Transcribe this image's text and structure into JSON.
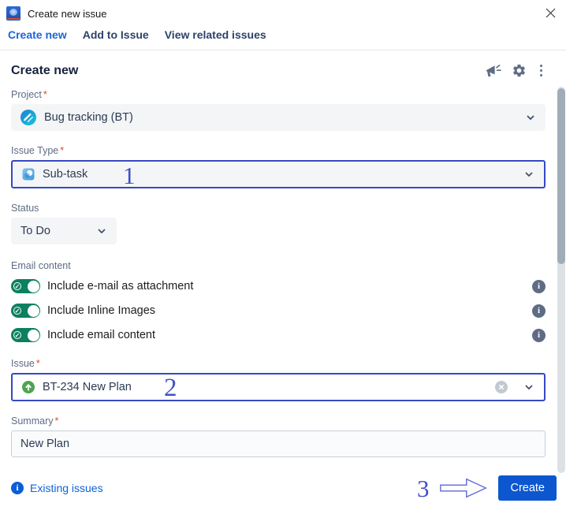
{
  "window": {
    "title": "Create new issue"
  },
  "tabs": [
    {
      "label": "Create new",
      "active": true
    },
    {
      "label": "Add to Issue",
      "active": false
    },
    {
      "label": "View related issues",
      "active": false
    }
  ],
  "section": {
    "heading": "Create new"
  },
  "form": {
    "required_marker": "*",
    "project": {
      "label": "Project",
      "required": true,
      "value": "Bug tracking (BT)"
    },
    "issue_type": {
      "label": "Issue Type",
      "required": true,
      "value": "Sub-task"
    },
    "status": {
      "label": "Status",
      "required": false,
      "value": "To Do"
    },
    "email_content": {
      "label": "Email content",
      "toggles": [
        {
          "label": "Include e-mail as attachment",
          "on": true
        },
        {
          "label": "Include Inline Images",
          "on": true
        },
        {
          "label": "Include email content",
          "on": true
        }
      ],
      "toggle_check_glyph": "✓"
    },
    "issue": {
      "label": "Issue",
      "required": true,
      "value": "BT-234 New Plan"
    },
    "summary": {
      "label": "Summary",
      "required": true,
      "value": "New Plan"
    }
  },
  "footer": {
    "existing_issues_label": "Existing issues",
    "create_label": "Create",
    "info_glyph": "i"
  },
  "annotations": {
    "step1": "1",
    "step2": "2",
    "step3": "3"
  },
  "icons": {
    "app": "addin-logo",
    "close": "x",
    "announcement": "megaphone",
    "settings": "gear",
    "more": "kebab-dots",
    "chevron": "chevron-down",
    "project_avatar": "teal-circle-striped",
    "subtask": "blue-rounded-square",
    "issue_item": "green-circle-up-arrow",
    "clear": "x-in-gray-circle",
    "info": "i-in-circle",
    "arrow": "block-arrow-right"
  },
  "colors": {
    "accent_blue": "#0c57d0",
    "focus_border_blue": "#3549c4",
    "link_blue": "#0f62d6",
    "active_tab_blue": "#1b64da",
    "toggle_green": "#0c8061",
    "label_gray": "#5e6c84",
    "field_bg": "#f4f5f7",
    "required_red": "#de4b32",
    "annotation_blue": "#4050c8",
    "scroll_thumb": "#9fadb9"
  }
}
